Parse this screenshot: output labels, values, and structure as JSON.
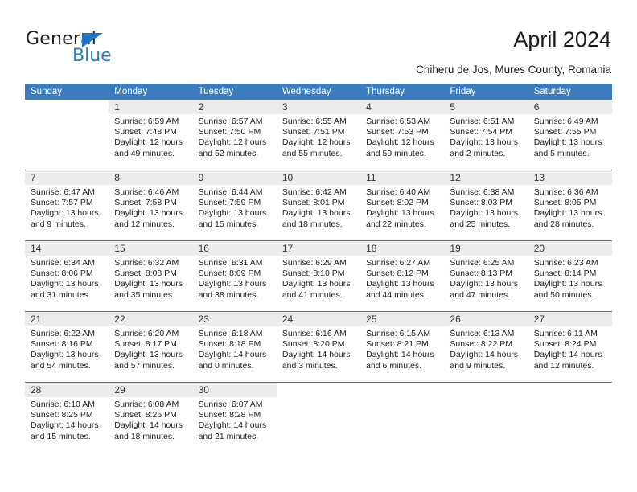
{
  "brand": {
    "name_top": "General",
    "name_bottom": "Blue",
    "triangle_color": "#1f77c4",
    "blue_text_color": "#2b7cc4"
  },
  "header": {
    "title": "April 2024",
    "subtitle": "Chiheru de Jos, Mures County, Romania"
  },
  "colors": {
    "header_band": "#3b7cbf",
    "day_number_strip": "#ececec",
    "week_divider": "#3b7cbf",
    "text": "#222222"
  },
  "weekdays": [
    "Sunday",
    "Monday",
    "Tuesday",
    "Wednesday",
    "Thursday",
    "Friday",
    "Saturday"
  ],
  "weeks": [
    {
      "days": [
        {
          "num": "",
          "lines": []
        },
        {
          "num": "1",
          "lines": [
            "Sunrise: 6:59 AM",
            "Sunset: 7:48 PM",
            "Daylight: 12 hours",
            "and 49 minutes."
          ]
        },
        {
          "num": "2",
          "lines": [
            "Sunrise: 6:57 AM",
            "Sunset: 7:50 PM",
            "Daylight: 12 hours",
            "and 52 minutes."
          ]
        },
        {
          "num": "3",
          "lines": [
            "Sunrise: 6:55 AM",
            "Sunset: 7:51 PM",
            "Daylight: 12 hours",
            "and 55 minutes."
          ]
        },
        {
          "num": "4",
          "lines": [
            "Sunrise: 6:53 AM",
            "Sunset: 7:53 PM",
            "Daylight: 12 hours",
            "and 59 minutes."
          ]
        },
        {
          "num": "5",
          "lines": [
            "Sunrise: 6:51 AM",
            "Sunset: 7:54 PM",
            "Daylight: 13 hours",
            "and 2 minutes."
          ]
        },
        {
          "num": "6",
          "lines": [
            "Sunrise: 6:49 AM",
            "Sunset: 7:55 PM",
            "Daylight: 13 hours",
            "and 5 minutes."
          ]
        }
      ]
    },
    {
      "days": [
        {
          "num": "7",
          "lines": [
            "Sunrise: 6:47 AM",
            "Sunset: 7:57 PM",
            "Daylight: 13 hours",
            "and 9 minutes."
          ]
        },
        {
          "num": "8",
          "lines": [
            "Sunrise: 6:46 AM",
            "Sunset: 7:58 PM",
            "Daylight: 13 hours",
            "and 12 minutes."
          ]
        },
        {
          "num": "9",
          "lines": [
            "Sunrise: 6:44 AM",
            "Sunset: 7:59 PM",
            "Daylight: 13 hours",
            "and 15 minutes."
          ]
        },
        {
          "num": "10",
          "lines": [
            "Sunrise: 6:42 AM",
            "Sunset: 8:01 PM",
            "Daylight: 13 hours",
            "and 18 minutes."
          ]
        },
        {
          "num": "11",
          "lines": [
            "Sunrise: 6:40 AM",
            "Sunset: 8:02 PM",
            "Daylight: 13 hours",
            "and 22 minutes."
          ]
        },
        {
          "num": "12",
          "lines": [
            "Sunrise: 6:38 AM",
            "Sunset: 8:03 PM",
            "Daylight: 13 hours",
            "and 25 minutes."
          ]
        },
        {
          "num": "13",
          "lines": [
            "Sunrise: 6:36 AM",
            "Sunset: 8:05 PM",
            "Daylight: 13 hours",
            "and 28 minutes."
          ]
        }
      ]
    },
    {
      "days": [
        {
          "num": "14",
          "lines": [
            "Sunrise: 6:34 AM",
            "Sunset: 8:06 PM",
            "Daylight: 13 hours",
            "and 31 minutes."
          ]
        },
        {
          "num": "15",
          "lines": [
            "Sunrise: 6:32 AM",
            "Sunset: 8:08 PM",
            "Daylight: 13 hours",
            "and 35 minutes."
          ]
        },
        {
          "num": "16",
          "lines": [
            "Sunrise: 6:31 AM",
            "Sunset: 8:09 PM",
            "Daylight: 13 hours",
            "and 38 minutes."
          ]
        },
        {
          "num": "17",
          "lines": [
            "Sunrise: 6:29 AM",
            "Sunset: 8:10 PM",
            "Daylight: 13 hours",
            "and 41 minutes."
          ]
        },
        {
          "num": "18",
          "lines": [
            "Sunrise: 6:27 AM",
            "Sunset: 8:12 PM",
            "Daylight: 13 hours",
            "and 44 minutes."
          ]
        },
        {
          "num": "19",
          "lines": [
            "Sunrise: 6:25 AM",
            "Sunset: 8:13 PM",
            "Daylight: 13 hours",
            "and 47 minutes."
          ]
        },
        {
          "num": "20",
          "lines": [
            "Sunrise: 6:23 AM",
            "Sunset: 8:14 PM",
            "Daylight: 13 hours",
            "and 50 minutes."
          ]
        }
      ]
    },
    {
      "days": [
        {
          "num": "21",
          "lines": [
            "Sunrise: 6:22 AM",
            "Sunset: 8:16 PM",
            "Daylight: 13 hours",
            "and 54 minutes."
          ]
        },
        {
          "num": "22",
          "lines": [
            "Sunrise: 6:20 AM",
            "Sunset: 8:17 PM",
            "Daylight: 13 hours",
            "and 57 minutes."
          ]
        },
        {
          "num": "23",
          "lines": [
            "Sunrise: 6:18 AM",
            "Sunset: 8:18 PM",
            "Daylight: 14 hours",
            "and 0 minutes."
          ]
        },
        {
          "num": "24",
          "lines": [
            "Sunrise: 6:16 AM",
            "Sunset: 8:20 PM",
            "Daylight: 14 hours",
            "and 3 minutes."
          ]
        },
        {
          "num": "25",
          "lines": [
            "Sunrise: 6:15 AM",
            "Sunset: 8:21 PM",
            "Daylight: 14 hours",
            "and 6 minutes."
          ]
        },
        {
          "num": "26",
          "lines": [
            "Sunrise: 6:13 AM",
            "Sunset: 8:22 PM",
            "Daylight: 14 hours",
            "and 9 minutes."
          ]
        },
        {
          "num": "27",
          "lines": [
            "Sunrise: 6:11 AM",
            "Sunset: 8:24 PM",
            "Daylight: 14 hours",
            "and 12 minutes."
          ]
        }
      ]
    },
    {
      "days": [
        {
          "num": "28",
          "lines": [
            "Sunrise: 6:10 AM",
            "Sunset: 8:25 PM",
            "Daylight: 14 hours",
            "and 15 minutes."
          ]
        },
        {
          "num": "29",
          "lines": [
            "Sunrise: 6:08 AM",
            "Sunset: 8:26 PM",
            "Daylight: 14 hours",
            "and 18 minutes."
          ]
        },
        {
          "num": "30",
          "lines": [
            "Sunrise: 6:07 AM",
            "Sunset: 8:28 PM",
            "Daylight: 14 hours",
            "and 21 minutes."
          ]
        },
        {
          "num": "",
          "lines": []
        },
        {
          "num": "",
          "lines": []
        },
        {
          "num": "",
          "lines": []
        },
        {
          "num": "",
          "lines": []
        }
      ]
    }
  ]
}
